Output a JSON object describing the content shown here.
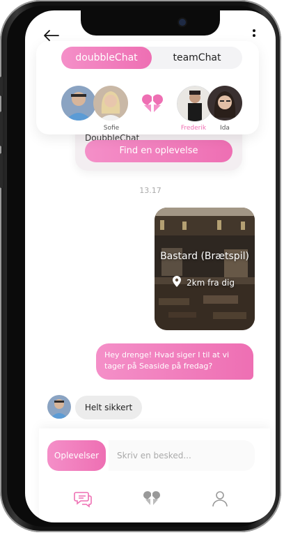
{
  "segment": {
    "active": "doubbleChat",
    "inactive": "teamChat"
  },
  "avatars": {
    "left_name": "Sofie",
    "right_names": [
      "Frederik",
      "Ida"
    ]
  },
  "message_card": {
    "text": "DoubbleChat",
    "button": "Find en oplevelse"
  },
  "timestamp": "13.17",
  "experience": {
    "title": "Bastard (Brætspil)",
    "distance": "2km fra dig"
  },
  "outgoing_message": "Hey drenge! Hvad siger I til at vi tager på Seaside på fredag?",
  "incoming_message": "Helt sikkert",
  "composer": {
    "experiences_button": "Oplevelser",
    "placeholder": "Skriv en besked..."
  },
  "colors": {
    "accent": "#ee6fb3",
    "accent_light": "#f48fc8"
  },
  "icons": [
    "back-arrow-icon",
    "more-vert-icon",
    "heart-logo-icon",
    "location-pin-icon",
    "chat-icon",
    "heart-nav-icon",
    "profile-icon"
  ]
}
